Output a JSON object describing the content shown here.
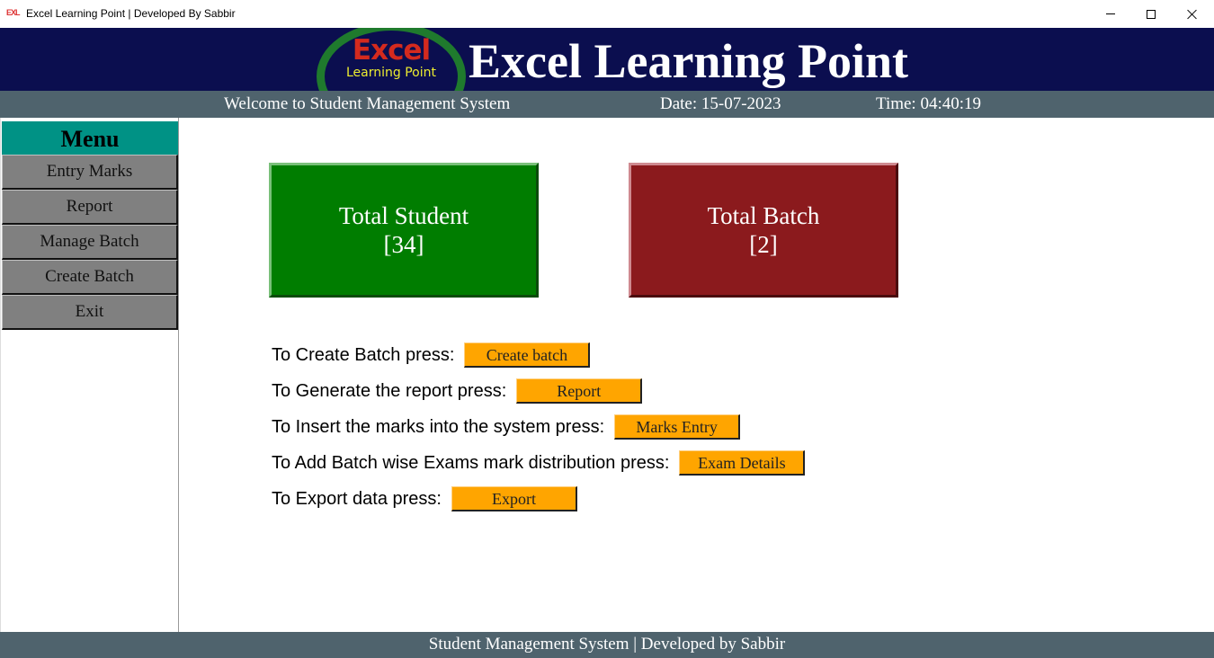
{
  "window": {
    "title": "Excel Learning Point | Developed By Sabbir",
    "app_icon": "excel-logo-icon",
    "controls": [
      "minimize",
      "maximize",
      "close"
    ]
  },
  "banner": {
    "logo_main": "Excel",
    "logo_sub": "Learning Point",
    "title": "Excel Learning Point"
  },
  "infobar": {
    "welcome": "Welcome to Student Management System",
    "date": "Date: 15-07-2023",
    "time": "Time: 04:40:19"
  },
  "sidebar": {
    "header": "Menu",
    "items": [
      {
        "label": "Entry Marks"
      },
      {
        "label": "Report"
      },
      {
        "label": "Manage Batch"
      },
      {
        "label": "Create Batch"
      },
      {
        "label": "Exit"
      }
    ]
  },
  "cards": {
    "student": {
      "title": "Total Student",
      "value": "[34]",
      "color": "#007d00"
    },
    "batch": {
      "title": "Total Batch",
      "value": "[2]",
      "color": "#8b1a1d"
    }
  },
  "actions": [
    {
      "label": "To Create Batch press:",
      "button": "Create batch"
    },
    {
      "label": "To Generate the report press:",
      "button": "Report"
    },
    {
      "label": "To Insert the marks into the system press:",
      "button": "Marks Entry"
    },
    {
      "label": "To Add Batch wise Exams mark distribution press:",
      "button": "Exam Details"
    },
    {
      "label": "To Export data press:",
      "button": "Export"
    }
  ],
  "footer": {
    "text": "Student Management System | Developed by Sabbir"
  },
  "colors": {
    "banner_bg": "#0b0e4f",
    "bar_bg": "#4f636d",
    "menu_header": "#009285",
    "menu_item": "#808080",
    "action_button": "#ffa500"
  }
}
